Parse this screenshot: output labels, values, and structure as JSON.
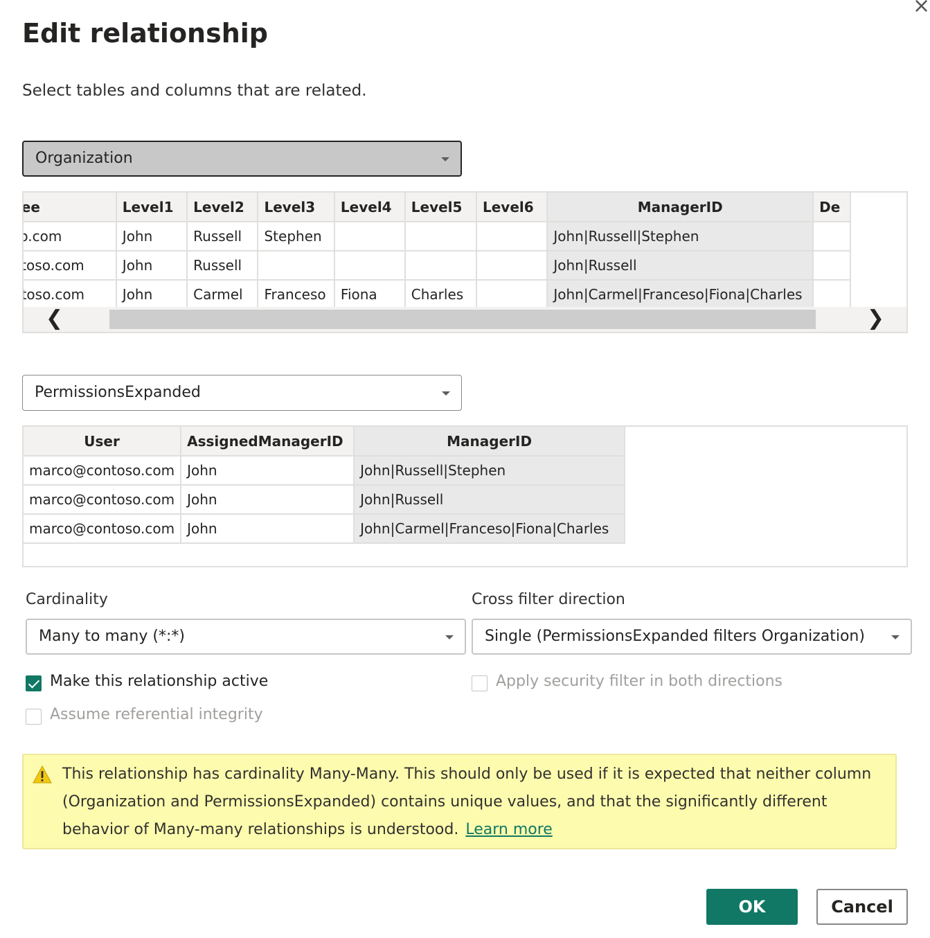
{
  "dialog": {
    "title": "Edit relationship",
    "subtitle": "Select tables and columns that are related.",
    "close_icon": "close-icon"
  },
  "table1": {
    "selected": "Organization",
    "columns": [
      "mployee",
      "Level1",
      "Level2",
      "Level3",
      "Level4",
      "Level5",
      "Level6",
      "ManagerID",
      "De"
    ],
    "rows": [
      [
        "contoso.com",
        "John",
        "Russell",
        "Stephen",
        "",
        "",
        "",
        "John|Russell|Stephen",
        ""
      ],
      [
        "e@contoso.com",
        "John",
        "Russell",
        "",
        "",
        "",
        "",
        "John|Russell",
        ""
      ],
      [
        "n@contoso.com",
        "John",
        "Carmel",
        "Franceso",
        "Fiona",
        "Charles",
        "",
        "John|Carmel|Franceso|Fiona|Charles",
        ""
      ]
    ],
    "scroll_left_glyph": "❮",
    "scroll_right_glyph": "❯"
  },
  "table2": {
    "selected": "PermissionsExpanded",
    "columns": [
      "User",
      "AssignedManagerID",
      "ManagerID"
    ],
    "rows": [
      [
        "marco@contoso.com",
        "John",
        "John|Russell|Stephen"
      ],
      [
        "marco@contoso.com",
        "John",
        "John|Russell"
      ],
      [
        "marco@contoso.com",
        "John",
        "John|Carmel|Franceso|Fiona|Charles"
      ]
    ]
  },
  "cardinality": {
    "label": "Cardinality",
    "value": "Many to many (*:*)"
  },
  "cross_filter": {
    "label": "Cross filter direction",
    "value": "Single (PermissionsExpanded filters Organization)"
  },
  "options": {
    "make_active": {
      "label": "Make this relationship active",
      "checked": true
    },
    "referential_integrity": {
      "label": "Assume referential integrity",
      "checked": false
    },
    "security_filter": {
      "label": "Apply security filter in both directions",
      "checked": false
    }
  },
  "warning": {
    "icon": "warning-icon",
    "text": "This relationship has cardinality Many-Many. This should only be used if it is expected that neither column (Organization and PermissionsExpanded) contains unique values, and that the significantly different behavior of Many-many relationships is understood.",
    "link": "Learn more"
  },
  "buttons": {
    "ok": "OK",
    "cancel": "Cancel"
  },
  "colors": {
    "accent": "#117865",
    "warning_bg": "#fdfbad"
  }
}
